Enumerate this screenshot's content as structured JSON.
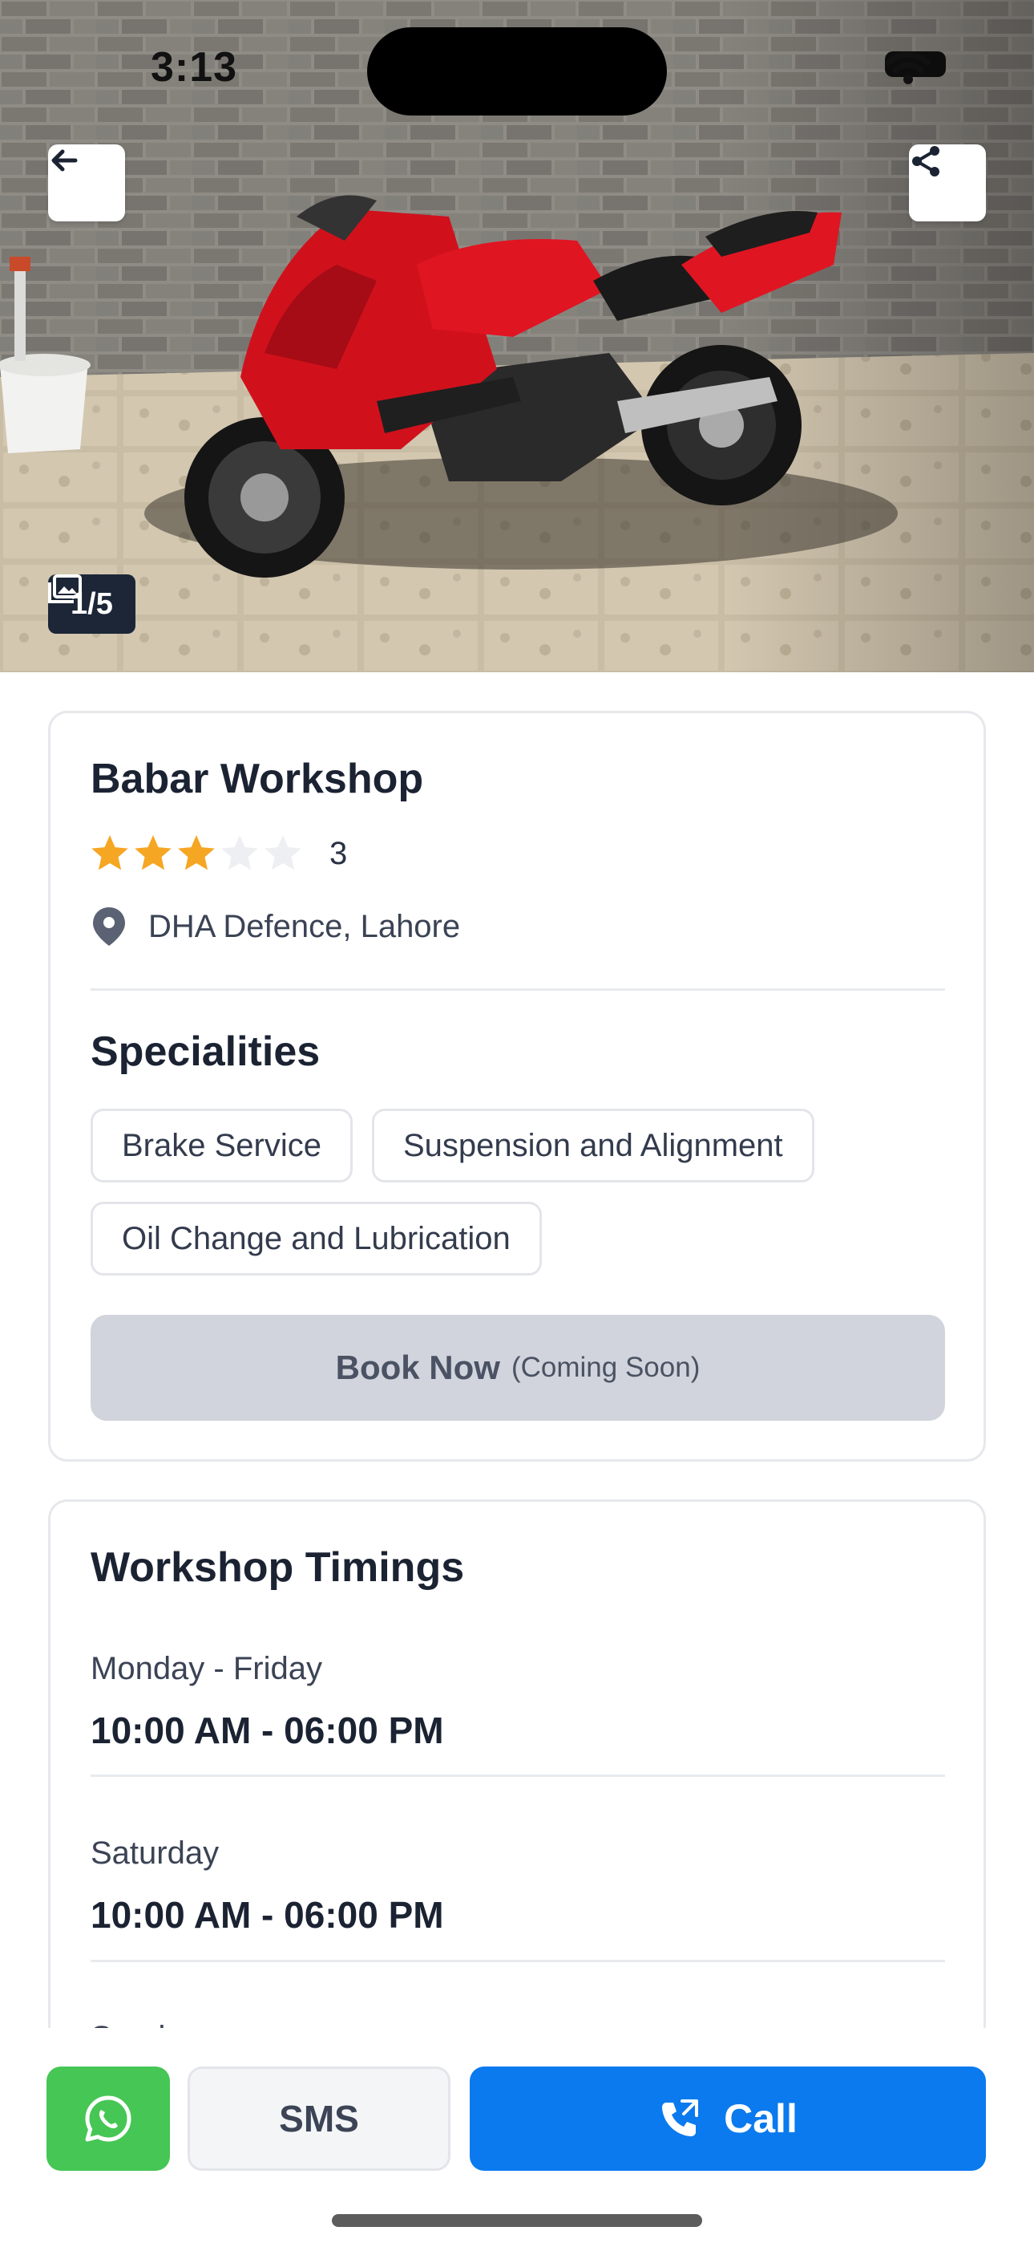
{
  "status_bar": {
    "time": "3:13"
  },
  "hero": {
    "image_alt": "Red sport motorcycle parked against a grey stone wall",
    "counter": "1/5",
    "icons": {
      "back": "arrow-left-icon",
      "share": "share-icon",
      "gallery": "images-icon"
    }
  },
  "workshop": {
    "name": "Babar Workshop",
    "rating": 3,
    "rating_max": 5,
    "rating_text": "3",
    "location": "DHA Defence, Lahore"
  },
  "specialities": {
    "title": "Specialities",
    "items": [
      "Brake Service",
      "Suspension and Alignment",
      "Oil Change and Lubrication"
    ]
  },
  "book": {
    "label": "Book Now",
    "note": "(Coming Soon)"
  },
  "timings": {
    "title": "Workshop Timings",
    "entries": [
      {
        "day": "Monday - Friday",
        "hours": "10:00 AM - 06:00 PM"
      },
      {
        "day": "Saturday",
        "hours": "10:00 AM - 06:00 PM"
      },
      {
        "day": "Sunday",
        "hours": ""
      }
    ]
  },
  "actions": {
    "sms": "SMS",
    "call": "Call"
  },
  "colors": {
    "star_filled": "#F5A623",
    "star_empty": "#EEEFF2",
    "whatsapp": "#46C655",
    "call": "#0A7AEE",
    "book_disabled": "#D1D4DC"
  }
}
